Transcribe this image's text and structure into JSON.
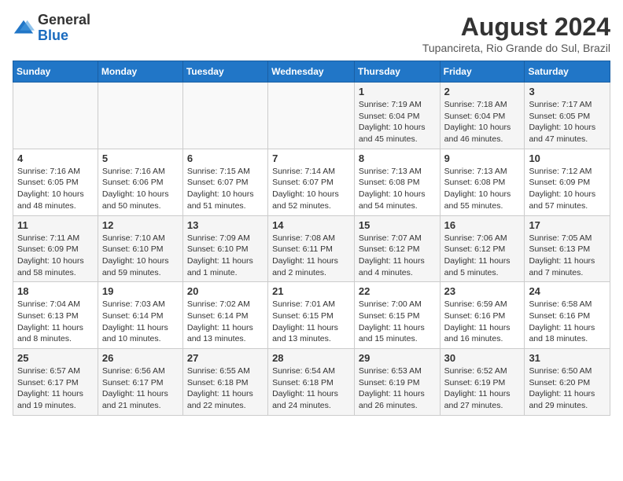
{
  "logo": {
    "general": "General",
    "blue": "Blue"
  },
  "header": {
    "month_year": "August 2024",
    "location": "Tupancireta, Rio Grande do Sul, Brazil"
  },
  "days_of_week": [
    "Sunday",
    "Monday",
    "Tuesday",
    "Wednesday",
    "Thursday",
    "Friday",
    "Saturday"
  ],
  "weeks": [
    [
      {
        "day": "",
        "info": ""
      },
      {
        "day": "",
        "info": ""
      },
      {
        "day": "",
        "info": ""
      },
      {
        "day": "",
        "info": ""
      },
      {
        "day": "1",
        "info": "Sunrise: 7:19 AM\nSunset: 6:04 PM\nDaylight: 10 hours and 45 minutes."
      },
      {
        "day": "2",
        "info": "Sunrise: 7:18 AM\nSunset: 6:04 PM\nDaylight: 10 hours and 46 minutes."
      },
      {
        "day": "3",
        "info": "Sunrise: 7:17 AM\nSunset: 6:05 PM\nDaylight: 10 hours and 47 minutes."
      }
    ],
    [
      {
        "day": "4",
        "info": "Sunrise: 7:16 AM\nSunset: 6:05 PM\nDaylight: 10 hours and 48 minutes."
      },
      {
        "day": "5",
        "info": "Sunrise: 7:16 AM\nSunset: 6:06 PM\nDaylight: 10 hours and 50 minutes."
      },
      {
        "day": "6",
        "info": "Sunrise: 7:15 AM\nSunset: 6:07 PM\nDaylight: 10 hours and 51 minutes."
      },
      {
        "day": "7",
        "info": "Sunrise: 7:14 AM\nSunset: 6:07 PM\nDaylight: 10 hours and 52 minutes."
      },
      {
        "day": "8",
        "info": "Sunrise: 7:13 AM\nSunset: 6:08 PM\nDaylight: 10 hours and 54 minutes."
      },
      {
        "day": "9",
        "info": "Sunrise: 7:13 AM\nSunset: 6:08 PM\nDaylight: 10 hours and 55 minutes."
      },
      {
        "day": "10",
        "info": "Sunrise: 7:12 AM\nSunset: 6:09 PM\nDaylight: 10 hours and 57 minutes."
      }
    ],
    [
      {
        "day": "11",
        "info": "Sunrise: 7:11 AM\nSunset: 6:09 PM\nDaylight: 10 hours and 58 minutes."
      },
      {
        "day": "12",
        "info": "Sunrise: 7:10 AM\nSunset: 6:10 PM\nDaylight: 10 hours and 59 minutes."
      },
      {
        "day": "13",
        "info": "Sunrise: 7:09 AM\nSunset: 6:10 PM\nDaylight: 11 hours and 1 minute."
      },
      {
        "day": "14",
        "info": "Sunrise: 7:08 AM\nSunset: 6:11 PM\nDaylight: 11 hours and 2 minutes."
      },
      {
        "day": "15",
        "info": "Sunrise: 7:07 AM\nSunset: 6:12 PM\nDaylight: 11 hours and 4 minutes."
      },
      {
        "day": "16",
        "info": "Sunrise: 7:06 AM\nSunset: 6:12 PM\nDaylight: 11 hours and 5 minutes."
      },
      {
        "day": "17",
        "info": "Sunrise: 7:05 AM\nSunset: 6:13 PM\nDaylight: 11 hours and 7 minutes."
      }
    ],
    [
      {
        "day": "18",
        "info": "Sunrise: 7:04 AM\nSunset: 6:13 PM\nDaylight: 11 hours and 8 minutes."
      },
      {
        "day": "19",
        "info": "Sunrise: 7:03 AM\nSunset: 6:14 PM\nDaylight: 11 hours and 10 minutes."
      },
      {
        "day": "20",
        "info": "Sunrise: 7:02 AM\nSunset: 6:14 PM\nDaylight: 11 hours and 13 minutes."
      },
      {
        "day": "21",
        "info": "Sunrise: 7:01 AM\nSunset: 6:15 PM\nDaylight: 11 hours and 13 minutes."
      },
      {
        "day": "22",
        "info": "Sunrise: 7:00 AM\nSunset: 6:15 PM\nDaylight: 11 hours and 15 minutes."
      },
      {
        "day": "23",
        "info": "Sunrise: 6:59 AM\nSunset: 6:16 PM\nDaylight: 11 hours and 16 minutes."
      },
      {
        "day": "24",
        "info": "Sunrise: 6:58 AM\nSunset: 6:16 PM\nDaylight: 11 hours and 18 minutes."
      }
    ],
    [
      {
        "day": "25",
        "info": "Sunrise: 6:57 AM\nSunset: 6:17 PM\nDaylight: 11 hours and 19 minutes."
      },
      {
        "day": "26",
        "info": "Sunrise: 6:56 AM\nSunset: 6:17 PM\nDaylight: 11 hours and 21 minutes."
      },
      {
        "day": "27",
        "info": "Sunrise: 6:55 AM\nSunset: 6:18 PM\nDaylight: 11 hours and 22 minutes."
      },
      {
        "day": "28",
        "info": "Sunrise: 6:54 AM\nSunset: 6:18 PM\nDaylight: 11 hours and 24 minutes."
      },
      {
        "day": "29",
        "info": "Sunrise: 6:53 AM\nSunset: 6:19 PM\nDaylight: 11 hours and 26 minutes."
      },
      {
        "day": "30",
        "info": "Sunrise: 6:52 AM\nSunset: 6:19 PM\nDaylight: 11 hours and 27 minutes."
      },
      {
        "day": "31",
        "info": "Sunrise: 6:50 AM\nSunset: 6:20 PM\nDaylight: 11 hours and 29 minutes."
      }
    ]
  ]
}
